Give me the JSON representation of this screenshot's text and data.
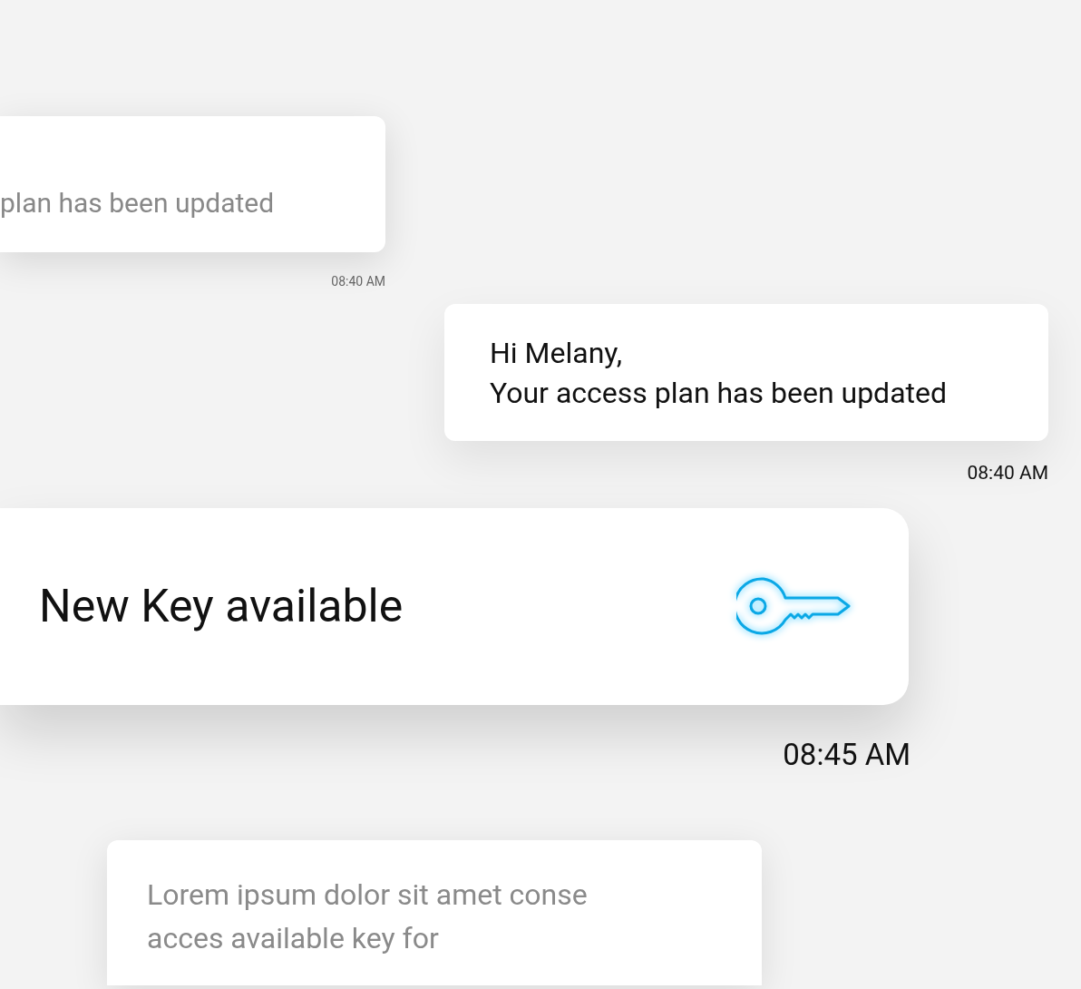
{
  "messages": [
    {
      "kind": "faded",
      "lines": [
        "plan has been updated"
      ],
      "time": "08:40 AM"
    },
    {
      "kind": "normal",
      "lines": [
        "Hi Melany,",
        "Your access plan has been updated"
      ],
      "time": "08:40 AM"
    },
    {
      "kind": "featured",
      "lines": [
        "New Key available"
      ],
      "time": "08:45 AM"
    },
    {
      "kind": "faded-bottom",
      "lines": [
        "Lorem ipsum dolor sit amet conse",
        "acces available key for"
      ]
    }
  ]
}
